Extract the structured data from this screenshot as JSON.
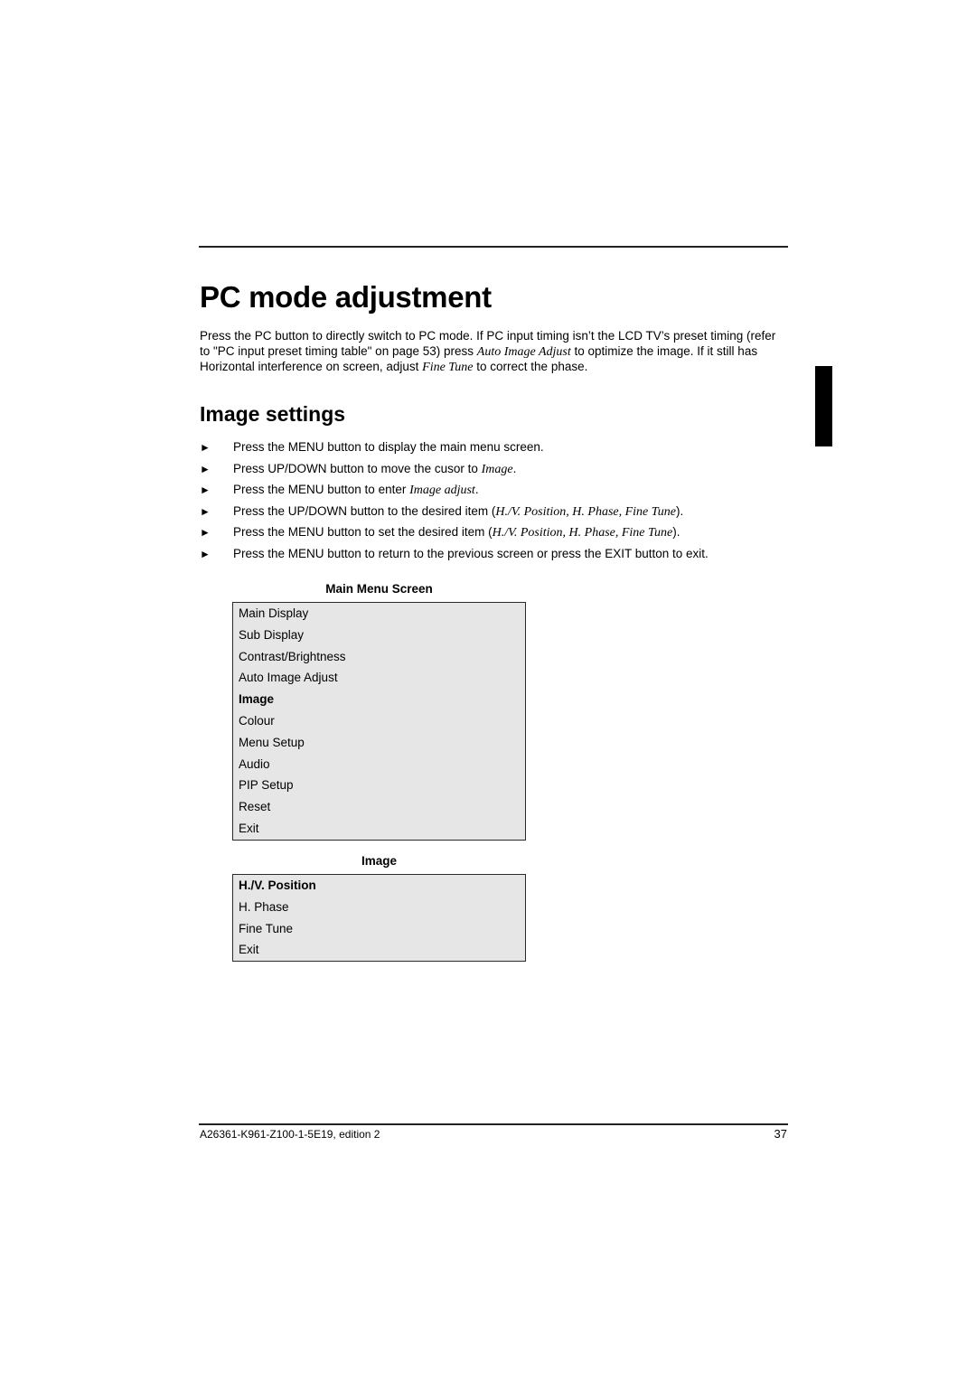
{
  "page": {
    "title": "PC mode adjustment",
    "intro": {
      "part1": "Press the PC button to directly switch to PC mode. If PC input timing isn’t the LCD TV’s preset timing (refer to \"PC input preset timing table\" on page 53) press ",
      "em1": "Auto Image Adjust",
      "part2": " to optimize the image. If it still has Horizontal interference on screen, adjust ",
      "em2": "Fine Tune",
      "part3": " to correct the phase."
    },
    "section_title": "Image settings",
    "bullet_glyph": "►",
    "steps": [
      {
        "text": "Press the MENU button to display the main menu screen.",
        "em": "",
        "after": ""
      },
      {
        "text": "Press UP/DOWN  button to move the cusor to ",
        "em": "Image",
        "after": "."
      },
      {
        "text": "Press the MENU button to enter ",
        "em": "Image adjust",
        "after": "."
      },
      {
        "text": "Press the UP/DOWN button to the desired item (",
        "em": "H./V. Position, H. Phase, Fine Tune",
        "after": ")."
      },
      {
        "text": "Press the MENU button to set the desired item (",
        "em": "H./V. Position, H. Phase, Fine Tune",
        "after": ")."
      },
      {
        "text": "Press the MENU button to return to the previous screen or press the EXIT button to exit.",
        "em": "",
        "after": ""
      }
    ],
    "main_menu": {
      "caption": "Main Menu Screen",
      "items": [
        "Main Display",
        "Sub Display",
        "Contrast/Brightness",
        "Auto Image Adjust",
        "Image",
        "Colour",
        "Menu Setup",
        "Audio",
        "PIP Setup",
        "Reset",
        "Exit"
      ],
      "selected": "Image"
    },
    "image_menu": {
      "caption": "Image",
      "items": [
        "H./V. Position",
        "H. Phase",
        "Fine Tune",
        "Exit"
      ],
      "selected": "H./V. Position"
    },
    "footer": {
      "doc_id": "A26361-K961-Z100-1-5E19, edition 2",
      "page_number": "37"
    }
  }
}
